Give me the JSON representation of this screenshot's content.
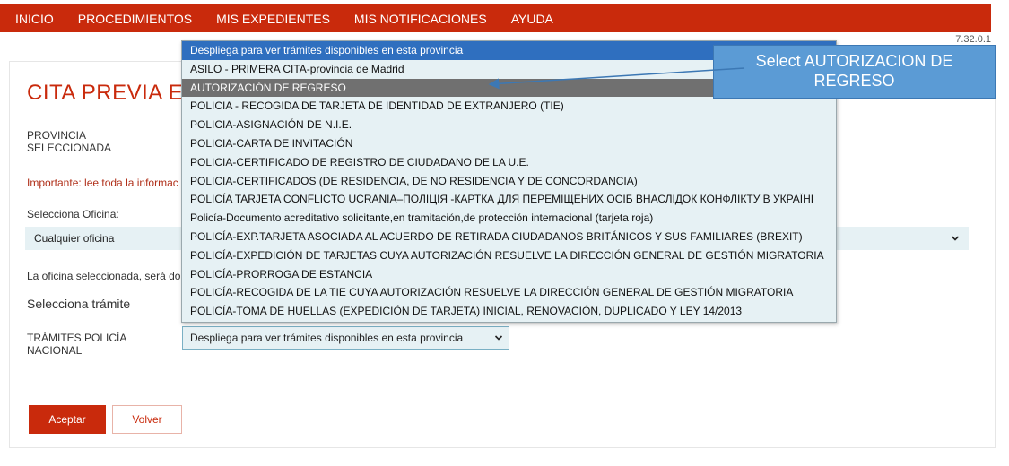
{
  "nav": {
    "items": [
      "INICIO",
      "PROCEDIMIENTOS",
      "MIS EXPEDIENTES",
      "MIS NOTIFICACIONES",
      "AYUDA"
    ]
  },
  "version": "7.32.0.1",
  "page": {
    "title": "CITA PREVIA E",
    "provincia_label": "PROVINCIA SELECCIONADA",
    "important_note": "Importante: lee toda la informac",
    "select_office_label": "Selecciona Oficina:",
    "office_value": "Cualquier oficina",
    "office_note": "La oficina seleccionada, será do",
    "tramite_label": "Selecciona trámite",
    "policia_label": "TRÁMITES POLICÍA NACIONAL",
    "procedure_select_value": "Despliega para ver trámites disponibles en esta provincia"
  },
  "buttons": {
    "accept": "Aceptar",
    "back": "Volver"
  },
  "dropdown": {
    "options": [
      "Despliega para ver trámites disponibles en esta provincia",
      "ASILO - PRIMERA CITA-provincia de Madrid",
      "AUTORIZACIÓN DE REGRESO",
      "POLICIA - RECOGIDA DE TARJETA DE IDENTIDAD DE EXTRANJERO (TIE)",
      "POLICIA-ASIGNACIÓN DE N.I.E.",
      "POLICIA-CARTA DE INVITACIÓN",
      "POLICIA-CERTIFICADO DE REGISTRO DE CIUDADANO DE LA U.E.",
      "POLICIA-CERTIFICADOS (DE RESIDENCIA, DE NO RESIDENCIA Y DE CONCORDANCIA)",
      "POLICÍA TARJETA CONFLICTO UCRANIA–ПОЛІЦІЯ -КАРТКА ДЛЯ ПЕРЕМІЩЕНИХ ОСІБ ВНАСЛІДОК КОНФЛІКТУ В УКРАЇНІ",
      "Policía-Documento acreditativo solicitante,en tramitación,de protección internacional (tarjeta roja)",
      "POLICÍA-EXP.TARJETA ASOCIADA AL ACUERDO DE RETIRADA CIUDADANOS BRITÁNICOS Y SUS FAMILIARES (BREXIT)",
      "POLICÍA-EXPEDICIÓN DE TARJETAS CUYA AUTORIZACIÓN RESUELVE LA DIRECCIÓN GENERAL DE GESTIÓN MIGRATORIA",
      "POLICÍA-PRORROGA DE ESTANCIA",
      "POLICÍA-RECOGIDA DE LA TIE CUYA AUTORIZACIÓN RESUELVE LA DIRECCIÓN GENERAL DE GESTIÓN MIGRATORIA",
      "POLICÍA-TOMA DE HUELLAS (EXPEDICIÓN DE TARJETA) INICIAL, RENOVACIÓN, DUPLICADO Y LEY 14/2013"
    ],
    "selected_index": 0,
    "hover_index": 2
  },
  "callout": {
    "text": "Select AUTORIZACION  DE REGRESO"
  },
  "colors": {
    "brand": "#c92a0c",
    "select_bg": "#e6f1f4",
    "selected_option": "#2f6fbf",
    "hover_option": "#707070",
    "callout": "#5b9bd5"
  },
  "icons": {
    "select_arrow": "chevron-down-icon"
  }
}
